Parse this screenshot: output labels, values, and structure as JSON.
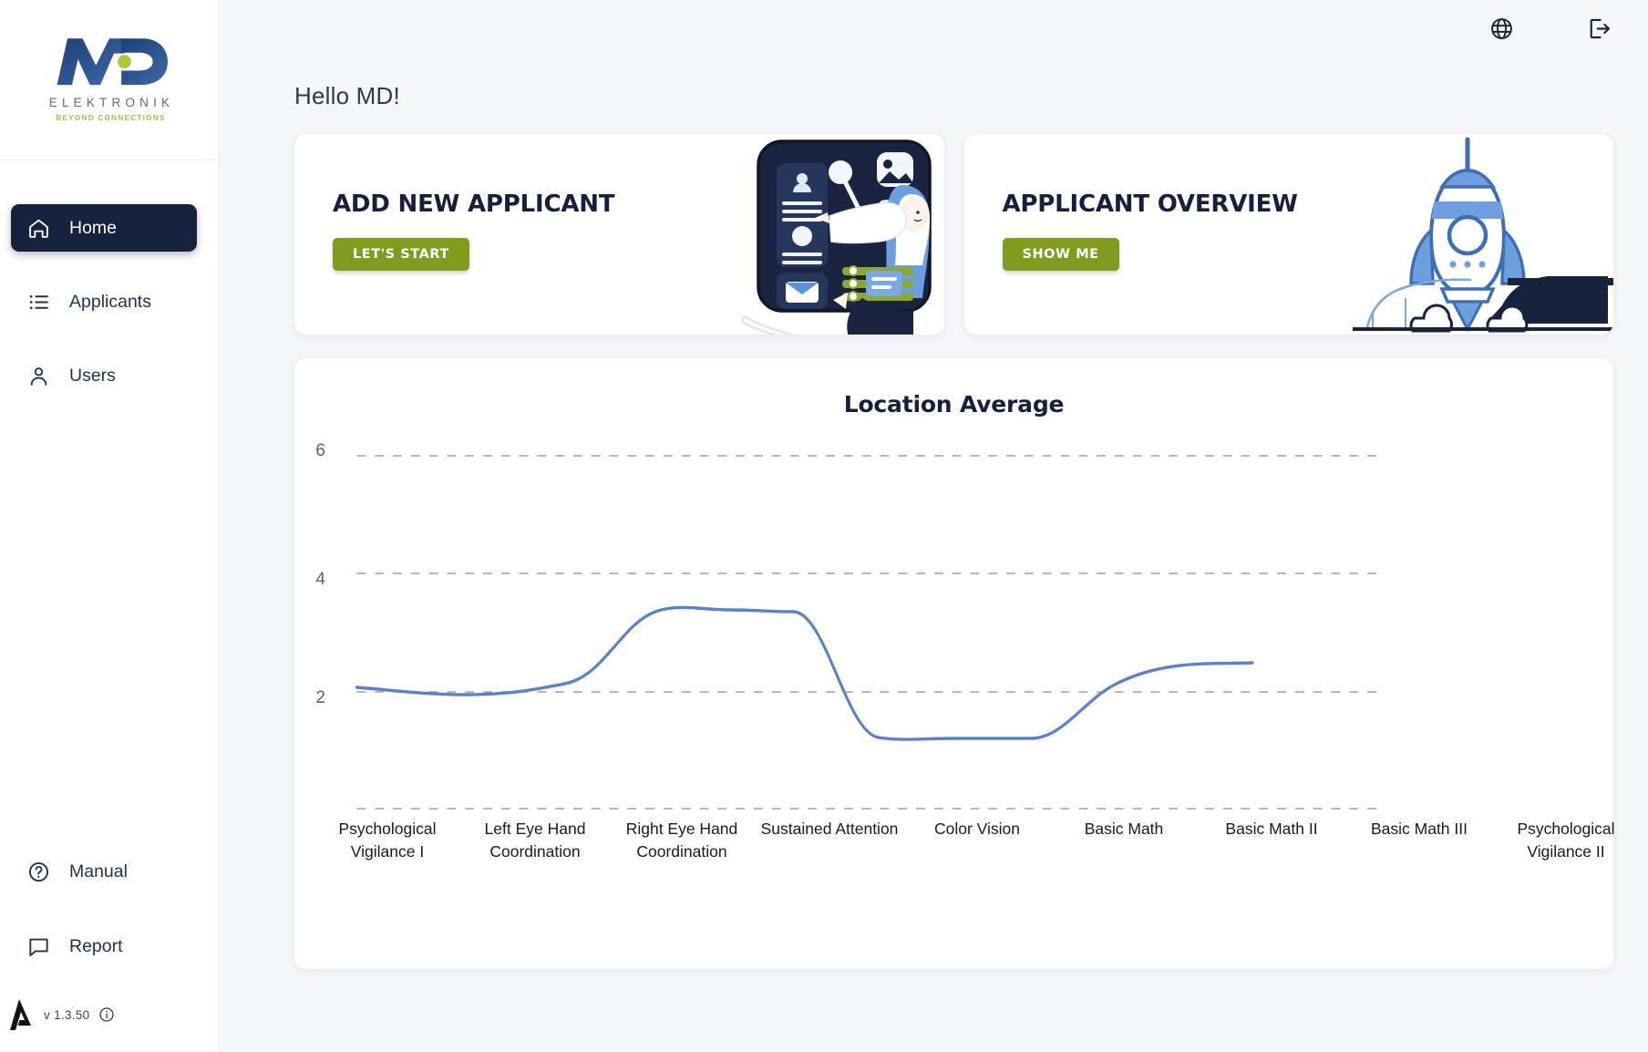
{
  "brand": {
    "name": "MD",
    "subtitle": "ELEKTRONIK",
    "tagline": "BEYOND CONNECTIONS",
    "accent_blue": "#2c4f86",
    "accent_green": "#a8b94a"
  },
  "sidebar": {
    "items": [
      {
        "label": "Home",
        "icon": "home-icon",
        "active": true
      },
      {
        "label": "Applicants",
        "icon": "list-icon",
        "active": false
      },
      {
        "label": "Users",
        "icon": "person-icon",
        "active": false
      }
    ],
    "bottom_items": [
      {
        "label": "Manual",
        "icon": "question-circle-icon"
      },
      {
        "label": "Report",
        "icon": "chat-bubble-icon"
      }
    ],
    "version": "v 1.3.50",
    "info_icon": "info-circle-icon",
    "brand_arrow_icon": "arrow-logo-icon"
  },
  "topbar": {
    "language_icon": "globe-icon",
    "logout_icon": "logout-icon"
  },
  "header": {
    "greeting": "Hello MD!"
  },
  "cards": [
    {
      "title": "ADD NEW APPLICANT",
      "button_label": "LET'S START",
      "button_color": "#7f9c21",
      "illustration": "woman-dashboard-illustration"
    },
    {
      "title": "APPLICANT OVERVIEW",
      "button_label": "SHOW ME",
      "button_color": "#7f9c21",
      "illustration": "rocket-launch-illustration"
    }
  ],
  "chart_data": {
    "type": "line",
    "title": "Location Average",
    "xlabel": "",
    "ylabel": "",
    "ylim": [
      0,
      7
    ],
    "yticks": [
      6,
      4,
      2
    ],
    "grid": true,
    "gridlines": [
      6,
      4,
      2,
      0
    ],
    "legend": "none",
    "line_color": "#5b82c4",
    "categories": [
      "Psychological Vigilance I",
      "Left Eye Hand Coordination",
      "Right Eye Hand Coordination",
      "Sustained Attention",
      "Color Vision",
      "Basic Math",
      "Basic Math II",
      "Basic Math III",
      "Psychological Vigilance II"
    ],
    "values": [
      2.08,
      2.0,
      2.1,
      3.38,
      3.38,
      1.22,
      1.22,
      1.75,
      2.45
    ]
  }
}
